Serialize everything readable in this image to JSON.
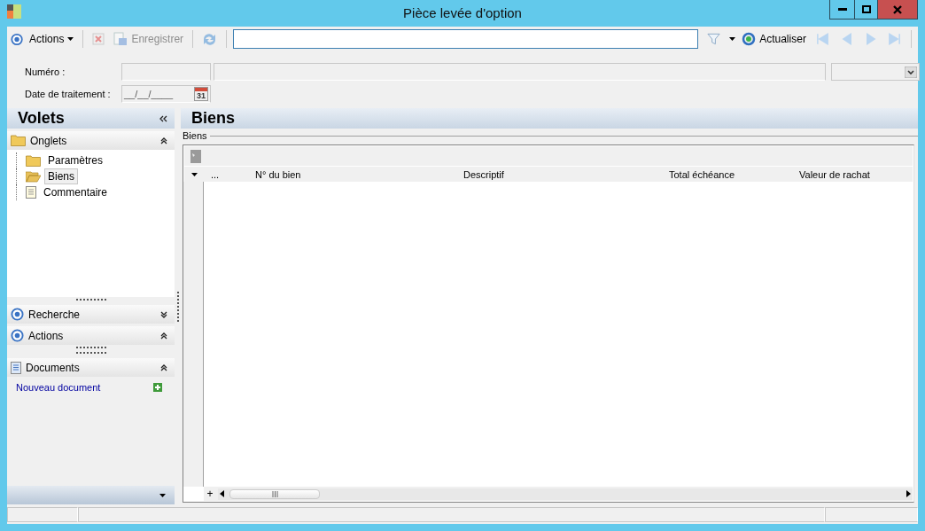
{
  "window": {
    "title": "Pièce levée d'option"
  },
  "toolbar": {
    "items": [
      {
        "kind": "menu",
        "label": "Actions",
        "disabled": false
      },
      {
        "kind": "delete",
        "disabled": true
      },
      {
        "kind": "save",
        "label": "Enregistrer",
        "disabled": true
      },
      {
        "kind": "sync",
        "disabled": true
      }
    ],
    "refresh": {
      "label": "Actualiser"
    },
    "navigation": [
      {
        "kind": "first",
        "disabled": true
      },
      {
        "kind": "previous",
        "disabled": true
      },
      {
        "kind": "next",
        "disabled": true
      },
      {
        "kind": "last",
        "disabled": true
      }
    ]
  },
  "form": {
    "number_label": "Numéro :",
    "date_label": "Date de traitement :",
    "date_value": "__/__/____",
    "calendar_day": "31"
  },
  "sidebar": {
    "title": "Volets",
    "sections": [
      {
        "kind": "tree",
        "title": "Onglets",
        "expanded": true,
        "items": [
          {
            "label": "Paramètres",
            "kind": "folder",
            "selected": false
          },
          {
            "label": "Biens",
            "kind": "folder",
            "selected": true
          },
          {
            "label": "Commentaire",
            "kind": "document",
            "selected": false
          }
        ]
      },
      {
        "kind": "search",
        "title": "Recherche",
        "expanded": false
      },
      {
        "kind": "actions",
        "title": "Actions",
        "expanded": true
      },
      {
        "kind": "documents",
        "title": "Documents",
        "expanded": true,
        "links": [
          "Nouveau document"
        ]
      }
    ]
  },
  "content": {
    "title": "Biens",
    "group_label": "Biens",
    "table": {
      "columns": [
        "...",
        "N° du bien",
        "Descriptif",
        "Total échéance",
        "Valeur de rachat"
      ],
      "add_row_glyph": "+"
    }
  }
}
